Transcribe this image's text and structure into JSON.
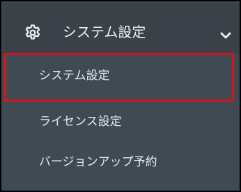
{
  "menu": {
    "header": {
      "icon": "gear-icon",
      "label": "システム設定",
      "expand_icon": "chevron-down-icon"
    },
    "items": [
      {
        "label": "システム設定",
        "highlighted": true
      },
      {
        "label": "ライセンス設定"
      },
      {
        "label": "バージョンアップ予約"
      }
    ]
  },
  "colors": {
    "panel_background": "#404a52",
    "header_background": "#3a4148",
    "text": "#e6e9ec",
    "highlight_border": "#d8141b"
  }
}
